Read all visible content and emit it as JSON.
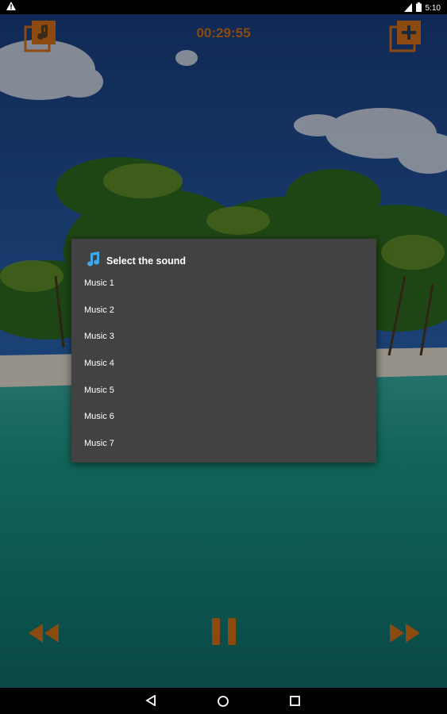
{
  "status_bar": {
    "time": "5:10",
    "icons": [
      "warning-icon",
      "no-sim-icon",
      "battery-icon"
    ]
  },
  "player": {
    "timer": "00:29:55"
  },
  "dialog": {
    "icon": "music-note-icon",
    "title": "Select the sound",
    "items": [
      {
        "label": "Music 1"
      },
      {
        "label": "Music 2"
      },
      {
        "label": "Music 3"
      },
      {
        "label": "Music 4"
      },
      {
        "label": "Music 5"
      },
      {
        "label": "Music 6"
      },
      {
        "label": "Music 7"
      }
    ]
  },
  "colors": {
    "accent": "#8c4a10",
    "dialog_bg": "#424242"
  }
}
